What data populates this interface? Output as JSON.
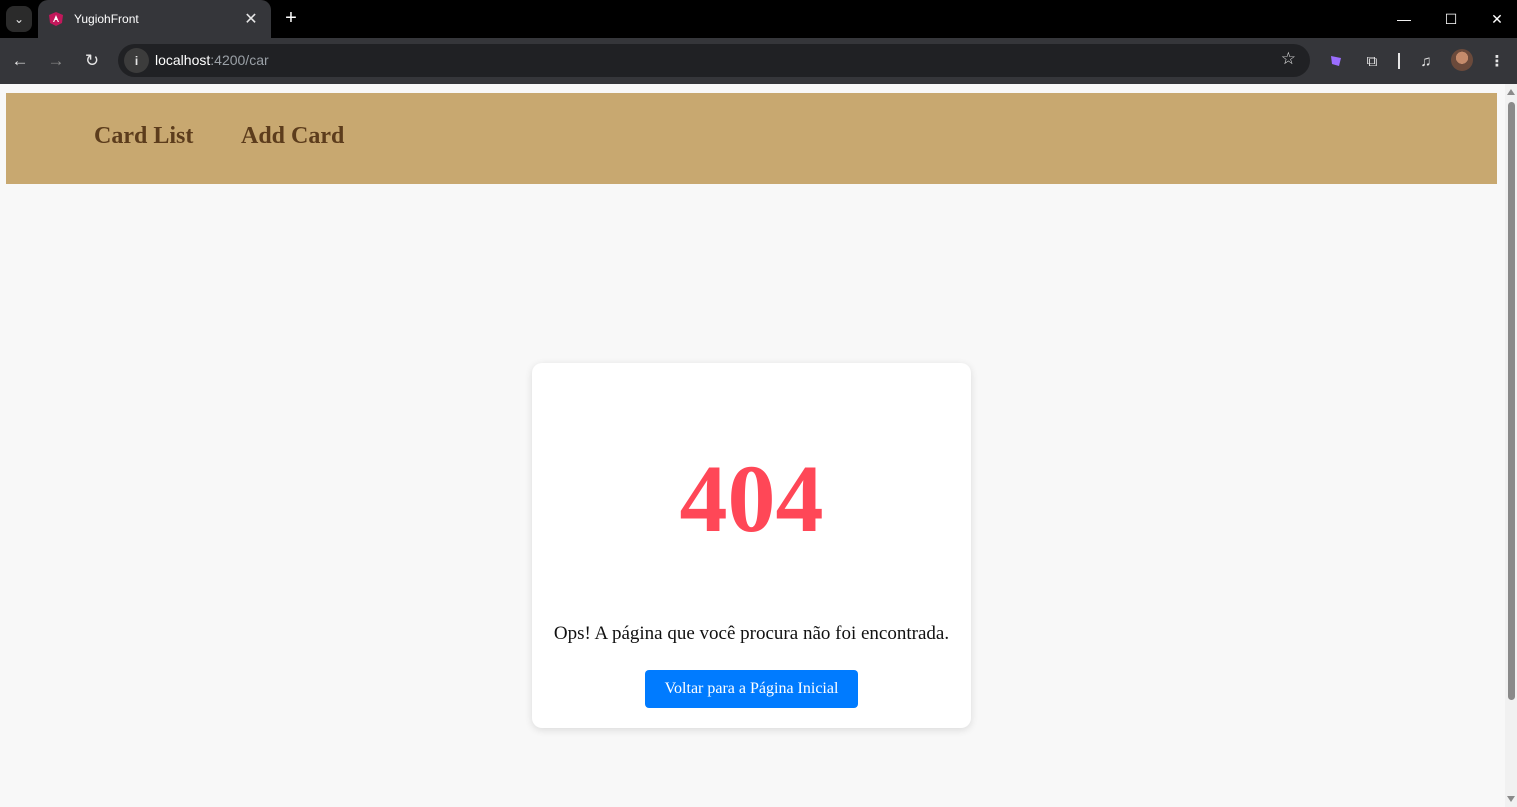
{
  "browser": {
    "tab": {
      "title": "YugiohFront",
      "favicon": "angular-logo-icon"
    },
    "address": {
      "host": "localhost",
      "path": ":4200/car"
    },
    "icons": [
      "tab-search-icon",
      "close-icon",
      "new-tab-icon",
      "back-arrow-icon",
      "forward-arrow-icon",
      "reload-icon",
      "site-info-icon",
      "bookmark-star-icon",
      "ai-extension-icon",
      "extensions-puzzle-icon",
      "media-control-icon",
      "profile-avatar",
      "kebab-menu-icon",
      "minimize-icon",
      "maximize-icon",
      "window-close-icon"
    ]
  },
  "nav": {
    "items": [
      {
        "label": "Card List"
      },
      {
        "label": "Add Card"
      }
    ]
  },
  "error": {
    "code": "404",
    "message": "Ops! A página que você procura não foi encontrada.",
    "button_label": "Voltar para a Página Inicial"
  },
  "colors": {
    "nav_bg": "#c8a870",
    "nav_text": "#5c3c1c",
    "error_code": "#ff4757",
    "button_bg": "#007bff",
    "page_bg": "#f8f8f8"
  }
}
